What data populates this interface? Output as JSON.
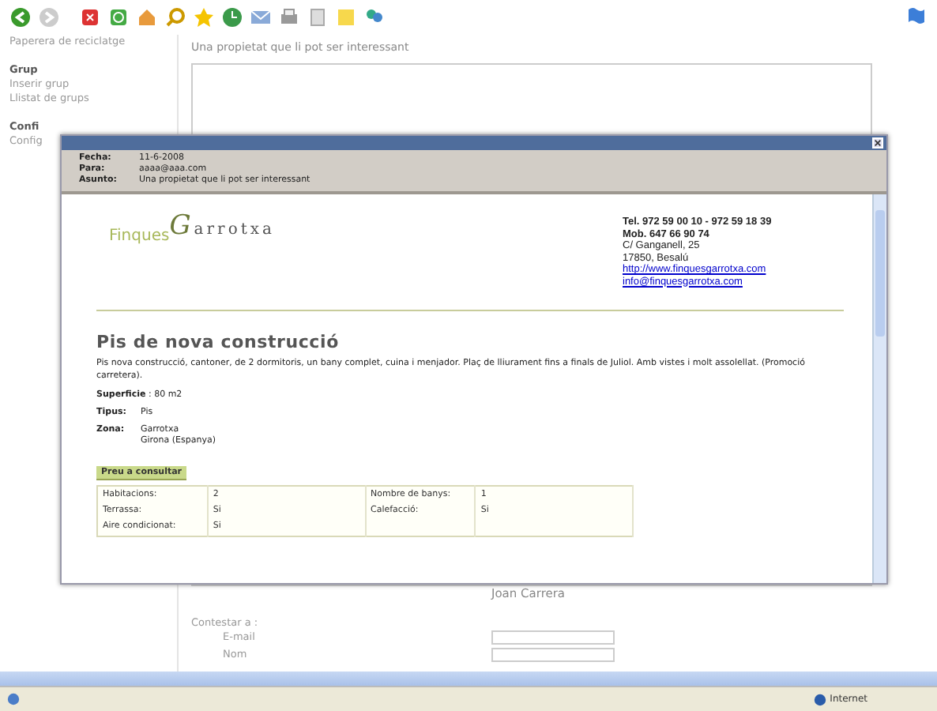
{
  "sidebar": {
    "items": [
      {
        "label": "Paperera de reciclatge",
        "kind": "link"
      },
      {
        "label": "Grup",
        "kind": "heading"
      },
      {
        "label": "Inserir grup",
        "kind": "link"
      },
      {
        "label": "Llistat de grups",
        "kind": "link"
      },
      {
        "label": "Confi",
        "kind": "heading"
      },
      {
        "label": "Config",
        "kind": "link"
      }
    ]
  },
  "message_form": {
    "subject": "Una propietat que li pot ser interessant",
    "sender_name": "Joan Carrera",
    "reply_label": "Contestar a :",
    "fields": [
      {
        "label": "E-mail"
      },
      {
        "label": "Nom"
      }
    ]
  },
  "popup": {
    "header": [
      {
        "label": "Fecha:",
        "value": "11-6-2008"
      },
      {
        "label": "Para:",
        "value": "aaaa@aaa.com"
      },
      {
        "label": "Asunto:",
        "value": "Una propietat que li pot ser interessant"
      }
    ],
    "logo": {
      "word_1": "Finques",
      "word_2": "Garrotxa"
    },
    "contact": [
      {
        "text": "Tel. 972 59 00 10 - 972 59 18 39",
        "kind": "bold"
      },
      {
        "text": "Mob. 647 66 90 74",
        "kind": "bold"
      },
      {
        "text": "C/ Ganganell, 25",
        "kind": "plain"
      },
      {
        "text": "17850, Besalú",
        "kind": "plain"
      },
      {
        "text": "http://www.finquesgarrotxa.com",
        "kind": "link"
      },
      {
        "text": "info@finquesgarrotxa.com",
        "kind": "link"
      }
    ],
    "listing": {
      "title": "Pis de nova construcció",
      "description": "Pis nova construcció, cantoner, de 2 dormitoris, un bany complet, cuina i menjador. Plaç de lliurament fins a finals de Juliol. Amb vistes i molt assolellat. (Promoció carretera).",
      "surface": "**Superficie** : 80 m2",
      "details": [
        {
          "label": "Tipus:",
          "values": [
            "Pis"
          ]
        },
        {
          "label": "Zona:",
          "values": [
            "Garrotxa",
            "Girona (Espanya)"
          ]
        }
      ],
      "price": "Preu a consultar",
      "features": [
        [
          {
            "label": "Habitacions:",
            "value": "2"
          },
          {
            "label": "Nombre de banys:",
            "value": "1"
          }
        ],
        [
          {
            "label": "Terrassa:",
            "value": "Si"
          },
          {
            "label": "Calefacció:",
            "value": "Si"
          }
        ],
        [
          {
            "label": "Aire condicionat:",
            "value": "Si"
          }
        ]
      ]
    }
  },
  "status_bar": {
    "zone": "Internet"
  }
}
